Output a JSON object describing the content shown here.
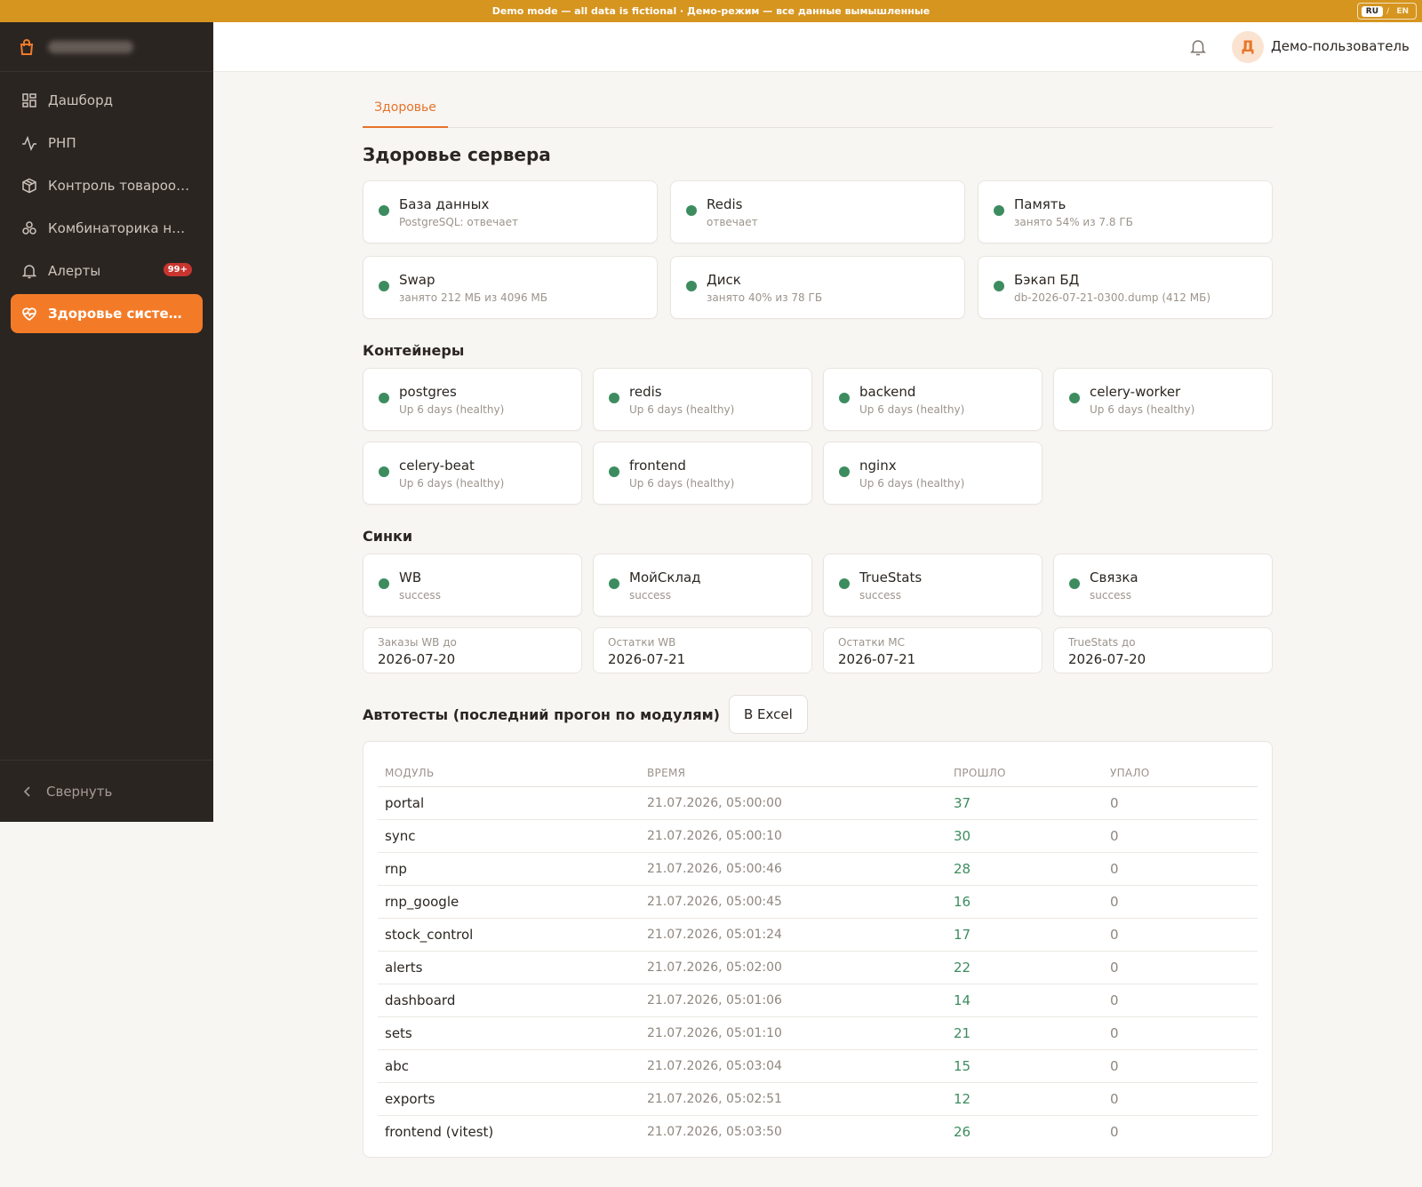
{
  "banner": {
    "text": "Demo mode — all data is fictional · Демо-режим — все данные вымышленные",
    "lang_ru": "RU",
    "lang_sep": "/",
    "lang_en": "EN"
  },
  "sidebar": {
    "items": [
      {
        "label": "Дашборд",
        "icon": "dashboard-icon"
      },
      {
        "label": "РНП",
        "icon": "activity-icon"
      },
      {
        "label": "Контроль товарооб...",
        "icon": "box-icon"
      },
      {
        "label": "Комбинаторика наб...",
        "icon": "combinatorics-icon"
      },
      {
        "label": "Алерты",
        "icon": "bell-icon",
        "badge": "99+"
      },
      {
        "label": "Здоровье системы",
        "icon": "heart-pulse-icon",
        "active": true
      }
    ],
    "collapse_label": "Свернуть"
  },
  "header": {
    "avatar_letter": "Д",
    "user_name": "Демо-пользователь"
  },
  "tabs": [
    {
      "label": "Здоровье"
    }
  ],
  "server": {
    "title": "Здоровье сервера",
    "cards": [
      {
        "title": "База данных",
        "sub": "PostgreSQL: отвечает"
      },
      {
        "title": "Redis",
        "sub": "отвечает"
      },
      {
        "title": "Память",
        "sub": "занято 54% из 7.8 ГБ"
      },
      {
        "title": "Swap",
        "sub": "занято 212 МБ из 4096 МБ"
      },
      {
        "title": "Диск",
        "sub": "занято 40% из 78 ГБ"
      },
      {
        "title": "Бэкап БД",
        "sub": "db-2026-07-21-0300.dump (412 МБ)"
      }
    ]
  },
  "containers": {
    "title": "Контейнеры",
    "cards": [
      {
        "title": "postgres",
        "sub": "Up 6 days (healthy)"
      },
      {
        "title": "redis",
        "sub": "Up 6 days (healthy)"
      },
      {
        "title": "backend",
        "sub": "Up 6 days (healthy)"
      },
      {
        "title": "celery-worker",
        "sub": "Up 6 days (healthy)"
      },
      {
        "title": "celery-beat",
        "sub": "Up 6 days (healthy)"
      },
      {
        "title": "frontend",
        "sub": "Up 6 days (healthy)"
      },
      {
        "title": "nginx",
        "sub": "Up 6 days (healthy)"
      }
    ]
  },
  "syncs": {
    "title": "Синки",
    "cards": [
      {
        "title": "WB",
        "sub": "success"
      },
      {
        "title": "МойСклад",
        "sub": "success"
      },
      {
        "title": "TrueStats",
        "sub": "success"
      },
      {
        "title": "Связка",
        "sub": "success"
      }
    ],
    "stats": [
      {
        "label": "Заказы WB до",
        "value": "2026-07-20"
      },
      {
        "label": "Остатки WB",
        "value": "2026-07-21"
      },
      {
        "label": "Остатки МС",
        "value": "2026-07-21"
      },
      {
        "label": "TrueStats до",
        "value": "2026-07-20"
      }
    ]
  },
  "tests": {
    "title": "Автотесты (последний прогон по модулям)",
    "excel_label": "В Excel",
    "columns": [
      "МОДУЛЬ",
      "ВРЕМЯ",
      "ПРОШЛО",
      "УПАЛО"
    ],
    "rows": [
      {
        "module": "portal",
        "time": "21.07.2026, 05:00:00",
        "passed": "37",
        "failed": "0"
      },
      {
        "module": "sync",
        "time": "21.07.2026, 05:00:10",
        "passed": "30",
        "failed": "0"
      },
      {
        "module": "rnp",
        "time": "21.07.2026, 05:00:46",
        "passed": "28",
        "failed": "0"
      },
      {
        "module": "rnp_google",
        "time": "21.07.2026, 05:00:45",
        "passed": "16",
        "failed": "0"
      },
      {
        "module": "stock_control",
        "time": "21.07.2026, 05:01:24",
        "passed": "17",
        "failed": "0"
      },
      {
        "module": "alerts",
        "time": "21.07.2026, 05:02:00",
        "passed": "22",
        "failed": "0"
      },
      {
        "module": "dashboard",
        "time": "21.07.2026, 05:01:06",
        "passed": "14",
        "failed": "0"
      },
      {
        "module": "sets",
        "time": "21.07.2026, 05:01:10",
        "passed": "21",
        "failed": "0"
      },
      {
        "module": "abc",
        "time": "21.07.2026, 05:03:04",
        "passed": "15",
        "failed": "0"
      },
      {
        "module": "exports",
        "time": "21.07.2026, 05:02:51",
        "passed": "12",
        "failed": "0"
      },
      {
        "module": "frontend (vitest)",
        "time": "21.07.2026, 05:03:50",
        "passed": "26",
        "failed": "0"
      }
    ]
  },
  "colors": {
    "banner": "#d6951f",
    "accent": "#f37b28",
    "sidebar": "#2b2522",
    "status_ok": "#3d8c5f",
    "badge": "#c8352f"
  }
}
